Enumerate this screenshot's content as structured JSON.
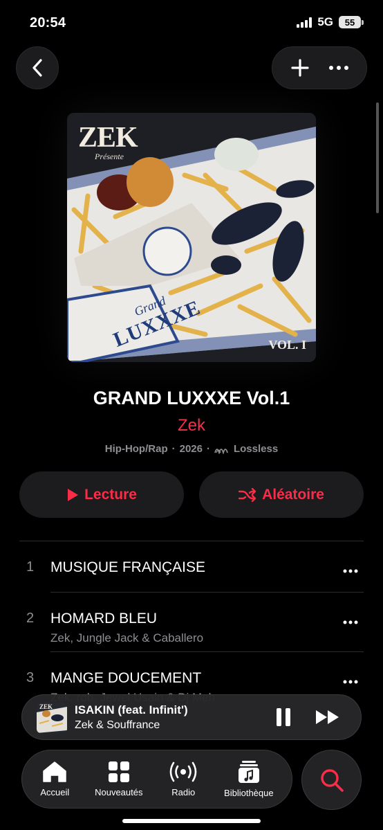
{
  "status": {
    "time": "20:54",
    "network": "5G",
    "battery": "55"
  },
  "album": {
    "title": "GRAND LUXXXE Vol.1",
    "artist": "Zek",
    "genre": "Hip-Hop/Rap",
    "year": "2026",
    "quality": "Lossless",
    "separator": "·"
  },
  "cover": {
    "logo": "ZEK",
    "subtitle": "Présente",
    "brand_line1": "Grand",
    "brand_line2": "LUXXXE",
    "volume": "VOL. I"
  },
  "buttons": {
    "play_label": "Lecture",
    "shuffle_label": "Aléatoire"
  },
  "tracks": [
    {
      "number": "1",
      "title": "MUSIQUE FRANÇAISE",
      "artists": ""
    },
    {
      "number": "2",
      "title": "HOMARD BLEU",
      "artists": "Zek, Jungle Jack & Caballero"
    },
    {
      "number": "3",
      "title": "MANGE DOUCEMENT",
      "artists": "Zek, rob, Jewel Usain & Dj Meh"
    }
  ],
  "now_playing": {
    "title": "ISAKIN (feat. Infinit')",
    "artist": "Zek & Souffrance",
    "art_logo": "ZEK"
  },
  "tabs": [
    {
      "label": "Accueil",
      "icon": "home-icon"
    },
    {
      "label": "Nouveautés",
      "icon": "grid-icon"
    },
    {
      "label": "Radio",
      "icon": "radio-icon"
    },
    {
      "label": "Bibliothèque",
      "icon": "library-icon"
    }
  ],
  "colors": {
    "accent": "#fa2d48",
    "background": "#000000",
    "surface": "#1c1c1e",
    "secondary_text": "#8e8e93"
  }
}
